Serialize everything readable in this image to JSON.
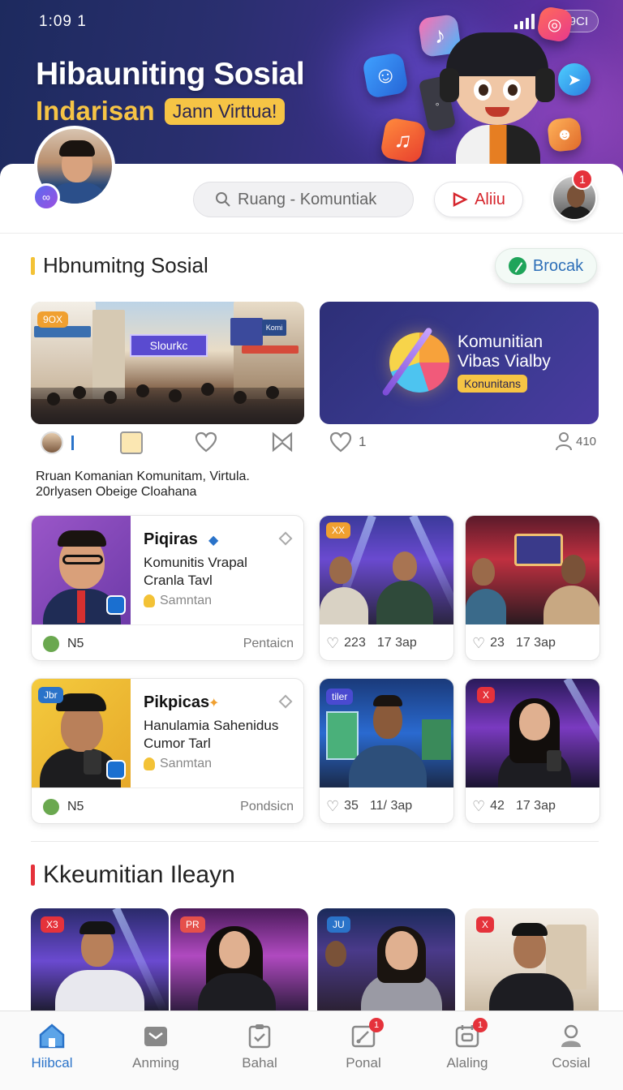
{
  "status_bar": {
    "time": "1:09 1",
    "pill_text": "9CI"
  },
  "hero": {
    "title": "Hibauniting Sosial",
    "subtitle": "Indarisan",
    "chip": "Jann Virttua!"
  },
  "topbar": {
    "search_placeholder": "Ruang - Komuntiak",
    "live_button": "Aliiu",
    "notification_count": "1"
  },
  "section1": {
    "title": "Hbnumitng Sosial",
    "accent": "#f3c236",
    "action_button": "Brocak",
    "featured_image": {
      "tag": "9OX",
      "sign": "Slourkc",
      "side_sign": "Komi"
    },
    "featured_card": {
      "line1": "Komunitian",
      "line2": "Vibas Vialby",
      "chip": "Konunitans"
    },
    "actions": {
      "likes": "1",
      "viewers": "410"
    },
    "description_line1": "Rruan Komanian Komunitam, Virtula.",
    "description_line2": "20rlyasen Obeige Cloahana"
  },
  "profile_cards": [
    {
      "title": "Piqiras",
      "line1": "Komunitis Vrapal",
      "line2": "Cranla Tavl",
      "line3": "Samntan",
      "foot_left": "N5",
      "foot_right": "Pentaicn",
      "thumb_color": "#8e4fc0",
      "tag": ""
    },
    {
      "title": "Pikpicas",
      "line1": "Hanulamia Sahenidus",
      "line2": "Cumor Tarl",
      "line3": "Sanmtan",
      "foot_left": "N5",
      "foot_right": "Pondsicn",
      "thumb_color": "#f0c43a",
      "tag": "Jbr"
    }
  ],
  "video_cards": [
    {
      "tag": "XX",
      "likes": "223",
      "time": "17 3ap"
    },
    {
      "tag": "",
      "likes": "23",
      "time": "17 3ap"
    },
    {
      "tag": "tiler",
      "likes": "35",
      "time": "11/ 3ap"
    },
    {
      "tag": "X",
      "likes": "42",
      "time": "17 3ap"
    }
  ],
  "section2": {
    "title": "Kkeumitian Ileayn",
    "accent": "#e5323b",
    "cards": [
      {
        "tag": "X3"
      },
      {
        "tag": "PR"
      },
      {
        "tag": "JU"
      },
      {
        "tag": "X"
      }
    ]
  },
  "bottom_nav": [
    {
      "label": "Hiibcal",
      "icon": "home-icon",
      "badge": ""
    },
    {
      "label": "Anming",
      "icon": "inbox-icon",
      "badge": ""
    },
    {
      "label": "Bahal",
      "icon": "clipboard-icon",
      "badge": ""
    },
    {
      "label": "Ponal",
      "icon": "edit-icon",
      "badge": "1"
    },
    {
      "label": "Alaling",
      "icon": "calendar-icon",
      "badge": "1"
    },
    {
      "label": "Cosial",
      "icon": "person-icon",
      "badge": ""
    }
  ]
}
